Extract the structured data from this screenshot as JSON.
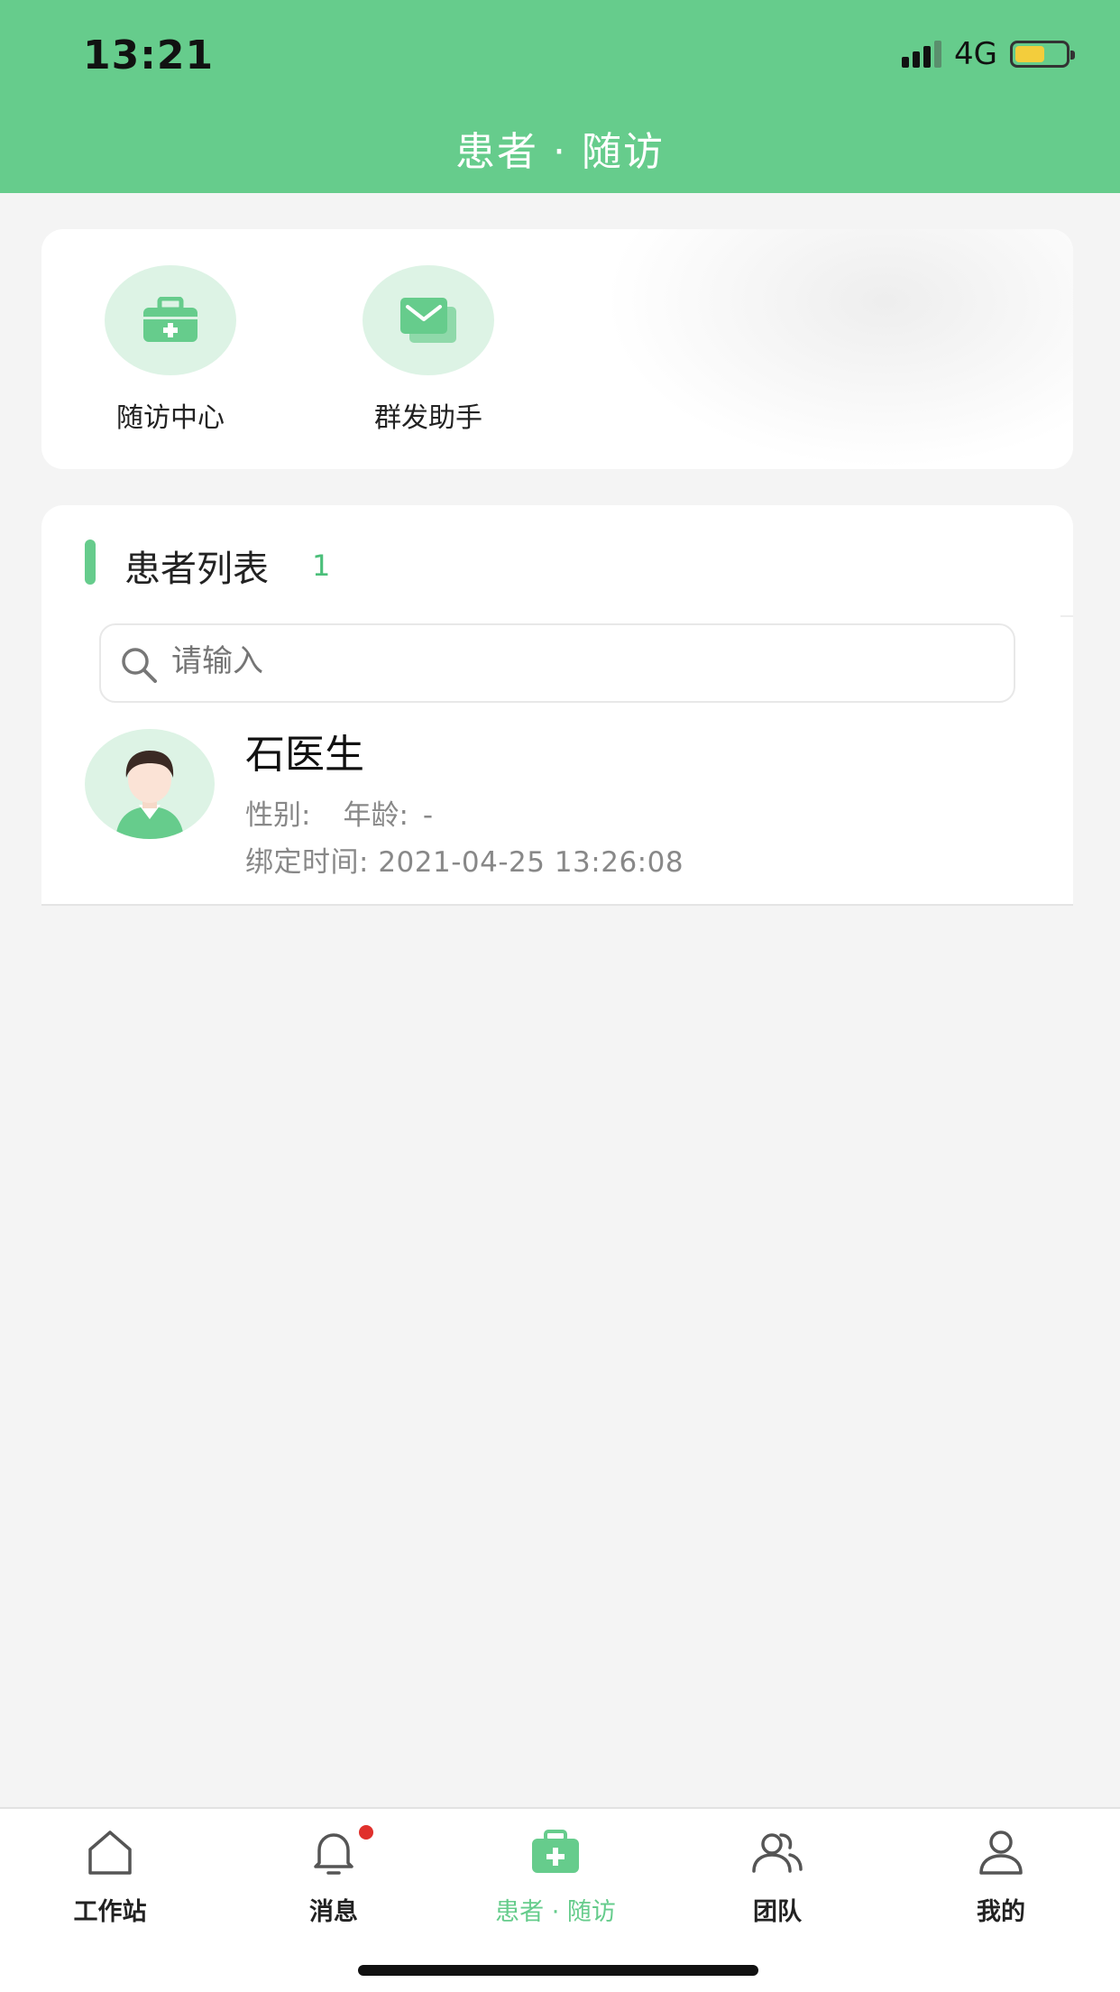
{
  "status_bar": {
    "time": "13:21",
    "network": "4G",
    "battery_level": 0.6
  },
  "header": {
    "title": "患者 · 随访"
  },
  "quick_actions": [
    {
      "label": "随访中心",
      "icon": "medical-kit-icon"
    },
    {
      "label": "群发助手",
      "icon": "mail-stack-icon"
    }
  ],
  "patient_list": {
    "title": "患者列表",
    "count": "1",
    "search_placeholder": "请输入",
    "items": [
      {
        "name": "石医生",
        "gender_label": "性别:",
        "gender": "",
        "age_label": "年龄:",
        "age": "-",
        "bind_label": "绑定时间:",
        "bind_time": "2021-04-25 13:26:08"
      }
    ]
  },
  "tabbar": {
    "items": [
      {
        "label": "工作站",
        "icon": "home-icon",
        "active": false
      },
      {
        "label": "消息",
        "icon": "bell-icon",
        "active": false,
        "badge": true
      },
      {
        "label": "患者 · 随访",
        "icon": "medical-kit-icon",
        "active": true
      },
      {
        "label": "团队",
        "icon": "team-icon",
        "active": false
      },
      {
        "label": "我的",
        "icon": "user-icon",
        "active": false
      }
    ]
  },
  "colors": {
    "primary": "#66cc8c",
    "light_green": "#ddf3e5",
    "badge": "#e0302c",
    "background": "#f4f4f4"
  }
}
